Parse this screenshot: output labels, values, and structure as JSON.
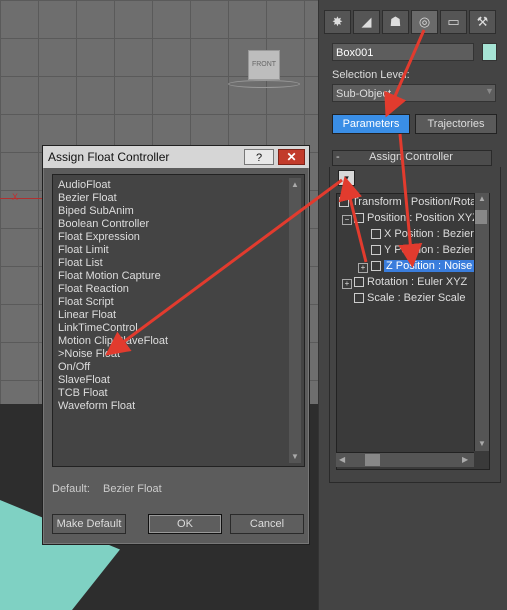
{
  "viewport": {
    "axis_label": "X",
    "viewcube_label": "FRONT"
  },
  "command_panel": {
    "tabs": [
      {
        "name": "create",
        "glyph": "✸"
      },
      {
        "name": "modify",
        "glyph": "◢"
      },
      {
        "name": "hierarchy",
        "glyph": "☗"
      },
      {
        "name": "motion",
        "glyph": "◎"
      },
      {
        "name": "display",
        "glyph": "▭"
      },
      {
        "name": "utilities",
        "glyph": "⚒"
      }
    ],
    "object_name": "Box001",
    "object_color": "#a6e4d5",
    "selection_level_label": "Selection Level:",
    "selection_level_value": "Sub-Object",
    "parameters_label": "Parameters",
    "trajectories_label": "Trajectories",
    "rollout_title": "Assign Controller",
    "rollout_toggle": "-",
    "tree": [
      {
        "label": "Transform : Position/Rotation/Scale",
        "selected": false
      },
      {
        "label": "Position : Position XYZ",
        "selected": false
      },
      {
        "label": "X Position : Bezier Float",
        "selected": false
      },
      {
        "label": "Y Position : Bezier Float",
        "selected": false
      },
      {
        "label": "Z Position : Noise Float",
        "selected": true
      },
      {
        "label": "Rotation : Euler XYZ",
        "selected": false
      },
      {
        "label": "Scale : Bezier Scale",
        "selected": false
      }
    ]
  },
  "dialog": {
    "title": "Assign Float Controller",
    "help_label": "?",
    "close_label": "✕",
    "controllers": [
      "AudioFloat",
      "Bezier Float",
      "Biped SubAnim",
      "Boolean Controller",
      "Float Expression",
      "Float Limit",
      "Float List",
      "Float Motion Capture",
      "Float Reaction",
      "Float Script",
      "Linear Float",
      "LinkTimeControl",
      "Motion Clip SlaveFloat",
      ">Noise Float",
      "On/Off",
      "SlaveFloat",
      "TCB Float",
      "Waveform Float"
    ],
    "default_label": "Default:",
    "default_value": "Bezier Float",
    "make_default_label": "Make Default",
    "ok_label": "OK",
    "cancel_label": "Cancel"
  },
  "colors": {
    "accent_blue": "#3a8ee6",
    "annotation_red": "#e23b2e"
  }
}
